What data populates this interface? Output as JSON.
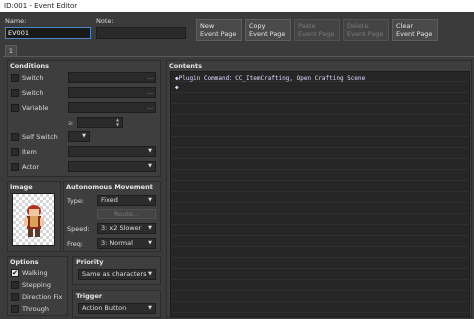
{
  "window": {
    "title": "ID:001 - Event Editor"
  },
  "header": {
    "name_label": "Name:",
    "name_value": "EV001",
    "note_label": "Note:",
    "note_value": ""
  },
  "toolbar": {
    "new_page": "New\nEvent Page",
    "copy_page": "Copy\nEvent Page",
    "paste_page": "Paste\nEvent Page",
    "delete_page": "Delete\nEvent Page",
    "clear_page": "Clear\nEvent Page"
  },
  "tabs": [
    {
      "label": "1"
    }
  ],
  "conditions": {
    "title": "Conditions",
    "switch1": "Switch",
    "switch2": "Switch",
    "variable": "Variable",
    "ge_symbol": "≥",
    "self_switch": "Self Switch",
    "item": "Item",
    "actor": "Actor",
    "ellipsis": "..."
  },
  "image": {
    "title": "Image"
  },
  "autonomous": {
    "title": "Autonomous Movement",
    "type_label": "Type:",
    "type_value": "Fixed",
    "route_label": "Route...",
    "speed_label": "Speed:",
    "speed_value": "3: x2 Slower",
    "freq_label": "Freq:",
    "freq_value": "3: Normal"
  },
  "options": {
    "title": "Options",
    "walking": "Walking",
    "stepping": "Stepping",
    "direction_fix": "Direction Fix",
    "through": "Through"
  },
  "priority": {
    "title": "Priority",
    "value": "Same as characters"
  },
  "trigger": {
    "title": "Trigger",
    "value": "Action Button"
  },
  "contents": {
    "title": "Contents",
    "line1": "◆Plugin Command：CC_ItemCrafting, Open Crafting Scene",
    "line2": "◆"
  },
  "colors": {
    "accent": "#4a86c8",
    "background": "#3b3b3b",
    "list_background": "#262626"
  }
}
